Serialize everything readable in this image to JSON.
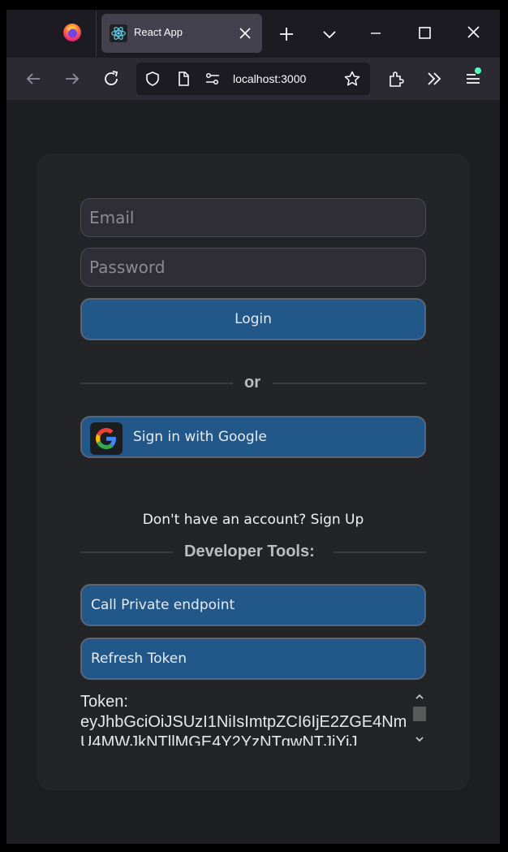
{
  "browser": {
    "tab_title": "React App",
    "url": "localhost:3000"
  },
  "login_form": {
    "email_placeholder": "Email",
    "password_placeholder": "Password",
    "login_label": "Login",
    "or_label": "or",
    "google_label": "Sign in with Google",
    "signup_text": "Don't have an account? Sign Up"
  },
  "developer_tools": {
    "heading": "Developer Tools:",
    "private_endpoint_label": "Call Private endpoint",
    "refresh_token_label": "Refresh Token",
    "token_label": "Token:",
    "token_value": "eyJhbGciOiJSUzI1NiIsImtpZCI6IjE2ZGE4NmU4MWJkNTllMGE4Y2YzNTgwNTJiYiJ"
  },
  "colors": {
    "button_bg": "#215789",
    "page_bg": "#1d1e21",
    "card_bg": "#232427"
  },
  "icons": [
    "firefox-logo-icon",
    "react-icon",
    "close-icon",
    "plus-icon",
    "chevron-down-icon",
    "minimize-icon",
    "maximize-icon",
    "window-close-icon",
    "back-icon",
    "forward-icon",
    "reload-icon",
    "shield-icon",
    "page-icon",
    "permissions-icon",
    "star-icon",
    "extensions-icon",
    "overflow-icon",
    "menu-icon",
    "google-icon"
  ]
}
